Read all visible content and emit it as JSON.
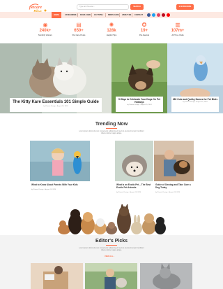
{
  "header": {
    "logo_line1": "petcare",
    "logo_line2": "Blog",
    "search_placeholder": "Type and hit enter...",
    "search_button": "SEARCH",
    "subscribe_button": "SUBSCRIBE"
  },
  "nav": {
    "items": [
      {
        "label": "HOME"
      },
      {
        "label": "CATEGORIES ▾"
      },
      {
        "label": "DOGS CARE"
      },
      {
        "label": "CAT TIPS ▾"
      },
      {
        "label": "BIRDS CARE"
      },
      {
        "label": "ABOUT ME"
      },
      {
        "label": "CONTACT"
      }
    ]
  },
  "stats": [
    {
      "value": "240k+",
      "label": "Monthly Visitors",
      "icon": "eye-icon"
    },
    {
      "value": "650+",
      "label": "Pet Care Posts",
      "icon": "document-icon"
    },
    {
      "value": "128k",
      "label": "Helpful Tips",
      "icon": "bulb-icon"
    },
    {
      "value": "19+",
      "label": "Pet Awards",
      "icon": "award-icon"
    },
    {
      "value": "107m+",
      "label": "All Time Visits",
      "icon": "chart-icon"
    }
  ],
  "hero": {
    "main": {
      "title": "The Kitty Kare Essentials 101 Simple Guide",
      "meta": "by Pawsie Design  ·  August 15, 2024"
    },
    "side1": {
      "title": "5 Ways to Celebrate Your Dogs On Pet Holidays",
      "meta": "by Pawsie Design  ·  August 15, 2024"
    },
    "side2": {
      "title": "280 Cute and Quirky Names for Pet Birds",
      "meta": "by Pawsie Design  ·  August 15, 2024"
    }
  },
  "trending": {
    "title": "Trending Now",
    "subtitle": "Lorem ipsum dolor sit amet consectetur adipiscing elit sed do eiusmod tempor incididunt labore dolore magna aliqua.",
    "posts": [
      {
        "title": "What to Know About Parrots With Your Kids",
        "meta": "by Pawsie Design  ·  August 15, 2024"
      },
      {
        "title": "What Is an Exotic Pet – The Best Exotic Pet Animals",
        "meta": "by Pawsie Design  ·  August 15, 2024"
      },
      {
        "title": "Guide of Owning and Take Care a Dog Today",
        "meta": "by Pawsie Design  ·  August 15, 2024"
      }
    ]
  },
  "picks": {
    "title": "Editor's Picks",
    "subtitle": "Lorem ipsum dolor sit amet consectetur adipiscing elit sed do eiusmod tempor incididunt labore dolore magna aliqua.",
    "view_all": "VIEW ALL ›"
  },
  "colors": {
    "accent": "#ff6d46",
    "nav_bg": "#fde9e2"
  }
}
